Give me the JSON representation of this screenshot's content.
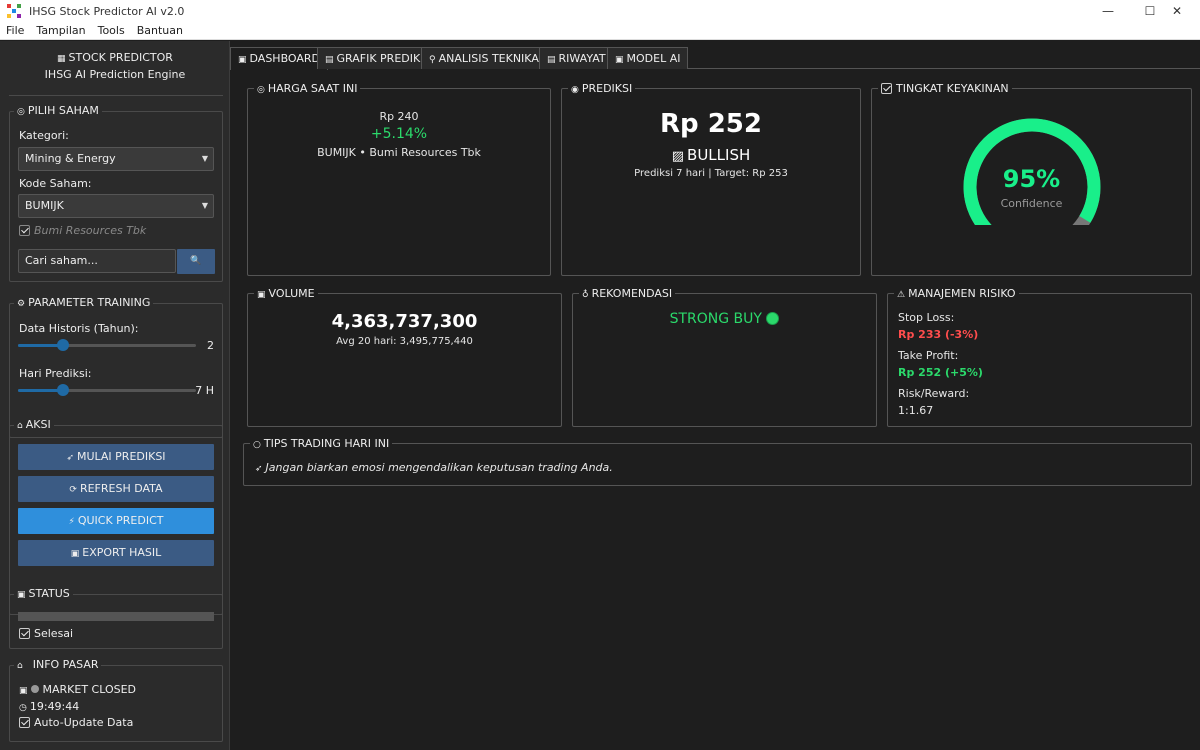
{
  "window": {
    "title": "IHSG Stock Predictor AI v2.0",
    "minimize": "—",
    "maximize": "☐",
    "close": "✕"
  },
  "menu": [
    "File",
    "Tampilan",
    "Tools",
    "Bantuan"
  ],
  "sidebar": {
    "title": "STOCK PREDICTOR",
    "subtitle": "IHSG AI Prediction Engine",
    "pilih_saham": {
      "title": "PILIH SAHAM",
      "kategori_label": "Kategori:",
      "kategori_value": "Mining & Energy",
      "kode_label": "Kode Saham:",
      "kode_value": "BUMIJK",
      "company": "Bumi Resources Tbk",
      "search_placeholder": "Cari saham...",
      "search_icon": "🔍"
    },
    "parameter": {
      "title": "PARAMETER TRAINING",
      "historis_label": "Data Historis (Tahun):",
      "historis_value": "2",
      "historis_level": 0.25,
      "hari_label": "Hari Prediksi:",
      "hari_value": "7 H",
      "hari_level": 0.25
    },
    "aksi": {
      "title": "AKSI",
      "mulai": "MULAI PREDIKSI",
      "refresh": "REFRESH DATA",
      "quick": "QUICK PREDICT",
      "export": "EXPORT HASIL"
    },
    "status": {
      "title": "STATUS",
      "text": "Selesai",
      "progress": 0
    },
    "info": {
      "title": "INFO PASAR",
      "market": "MARKET CLOSED",
      "time": "19:49:44",
      "auto": "Auto-Update Data"
    }
  },
  "tabs": [
    "DASHBOARD",
    "GRAFIK PREDIKSI",
    "ANALISIS TEKNIKAL",
    "RIWAYAT",
    "MODEL AI"
  ],
  "dashboard": {
    "harga": {
      "title": "HARGA SAAT INI",
      "price": "Rp 240",
      "change": "+5.14%",
      "name": "BUMIJK • Bumi Resources Tbk"
    },
    "prediksi": {
      "title": "PREDIKSI",
      "price": "Rp 252",
      "trend": "BULLISH",
      "detail": "Prediksi 7 hari | Target: Rp 253"
    },
    "keyakinan": {
      "title": "TINGKAT KEYAKINAN",
      "value": "95%",
      "label": "Confidence",
      "level": 0.95
    },
    "volume": {
      "title": "VOLUME",
      "value": "4,363,737,300",
      "avg": "Avg 20 hari: 3,495,775,440"
    },
    "rekomendasi": {
      "title": "REKOMENDASI",
      "value": "STRONG BUY"
    },
    "risiko": {
      "title": "MANAJEMEN RISIKO",
      "sl_label": "Stop Loss:",
      "sl_value": "Rp 233 (-3%)",
      "tp_label": "Take Profit:",
      "tp_value": "Rp 252 (+5%)",
      "rr_label": "Risk/Reward:",
      "rr_value": "1:1.67"
    },
    "tips": {
      "title": "TIPS TRADING HARI INI",
      "text": "Jangan biarkan emosi mengendalikan keputusan trading Anda."
    }
  },
  "colors": {
    "accent": "#1f6aa5",
    "button": "#3b5b84",
    "quick": "#2f8fdc",
    "positive": "#2bd96b",
    "negative": "#ff4d4d",
    "gauge": "#19ef8a"
  }
}
